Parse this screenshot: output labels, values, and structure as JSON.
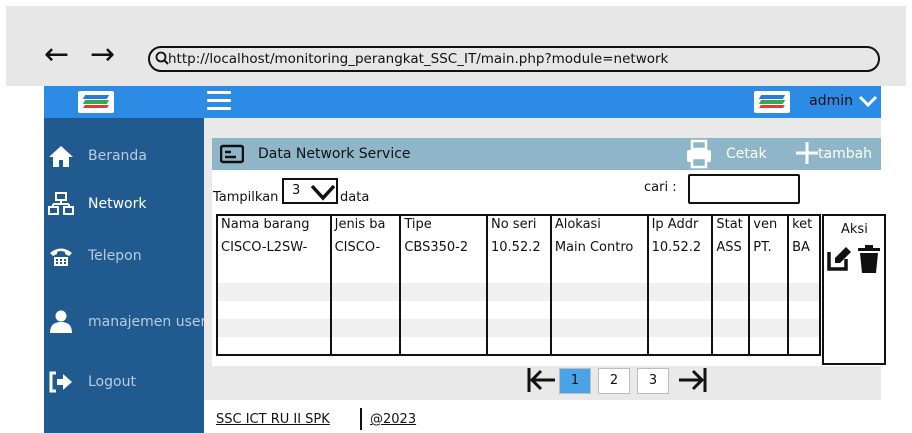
{
  "browser": {
    "url": "http://localhost/monitoring_perangkat_SSC_IT/main.php?module=network"
  },
  "topnav": {
    "user_label": "admin"
  },
  "sidebar": {
    "items": [
      {
        "label": "Beranda",
        "icon": "home-icon"
      },
      {
        "label": "Network",
        "icon": "network-icon"
      },
      {
        "label": "Telepon",
        "icon": "phone-icon"
      },
      {
        "label": "manajemen user",
        "icon": "user-icon"
      },
      {
        "label": "Logout",
        "icon": "logout-icon"
      }
    ]
  },
  "panel": {
    "title": "Data Network Service",
    "print_label": "Cetak",
    "add_label": "tambah"
  },
  "controls": {
    "show_label": "Tampilkan",
    "page_size": "3",
    "data_label": "data",
    "search_label": "cari :"
  },
  "table": {
    "headers": [
      "Nama barang",
      "Jenis ba",
      "Tipe",
      "No seri",
      "Alokasi",
      "Ip Addr",
      "Stat",
      "ven",
      "ket"
    ],
    "rows": [
      [
        "CISCO-L2SW-",
        "CISCO-",
        "CBS350-2",
        "10.52.2",
        "Main Contro",
        "10.52.2",
        "ASS",
        "PT.",
        "BA"
      ]
    ],
    "action_header": "Aksi"
  },
  "pagination": {
    "pages": [
      "1",
      "2",
      "3"
    ],
    "active": "1"
  },
  "footer": {
    "left": "SSC ICT RU II SPK",
    "right": "@2023"
  },
  "colors": {
    "topnav": "#2c8be5",
    "sidebar": "#215a8f",
    "panel_header": "#8fb6c8",
    "active_page": "#4aa3e6"
  }
}
